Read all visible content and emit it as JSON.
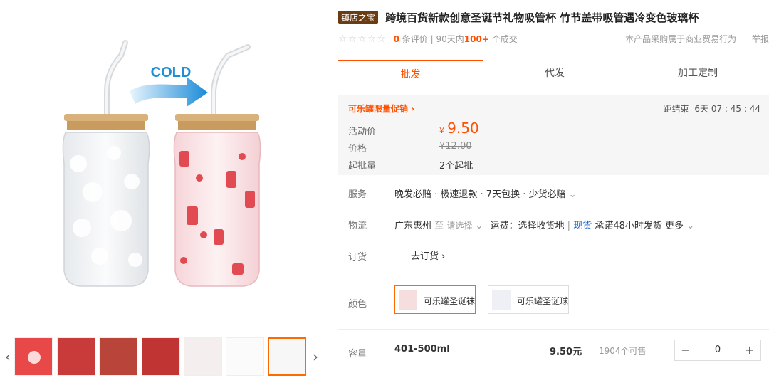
{
  "gallery": {
    "main_overlay": "COLD",
    "nav_prev": "‹",
    "nav_next": "›"
  },
  "product": {
    "badge": "镇店之宝",
    "title": "跨境百货新款创意圣诞节礼物吸管杯 竹节盖带吸管遇冷变色玻璃杯"
  },
  "rating": {
    "stars": "☆☆☆☆☆",
    "review_count": "0",
    "review_suffix": "条评价",
    "divider": "|",
    "sales_prefix": "90天内",
    "sales_count": "100+",
    "sales_suffix": "个成交",
    "notice": "本产品采购属于商业贸易行为",
    "notice_tail": "举报"
  },
  "tabs": [
    "批发",
    "代发",
    "加工定制"
  ],
  "promo": {
    "title": "可乐罐限量促销 ›",
    "countdown_label": "距结束",
    "countdown": "6天 07 : 45 : 44",
    "activity_label": "活动价",
    "currency": "¥",
    "activity_price": "9.50",
    "orig_label": "价格",
    "orig_price": "¥12.00",
    "moq_label": "起批量",
    "moq": "2个起批"
  },
  "service": {
    "label": "服务",
    "value": "晚发必赔 · 极速退款 · 7天包换 · 少货必赔",
    "chevron": "⌄"
  },
  "logistics": {
    "label": "物流",
    "origin": "广东惠州",
    "to": "至",
    "choose": "请选择",
    "chevron": "⌄",
    "fee": "运费：选择收货地",
    "stock": "现货",
    "promise": "承诺48小时发货",
    "more": "更多"
  },
  "order": {
    "label": "订货",
    "action": "去订货 ›"
  },
  "color": {
    "label": "颜色",
    "options": [
      "可乐罐圣诞袜",
      "可乐罐圣诞球"
    ]
  },
  "capacity": {
    "label": "容量",
    "value": "401-500ml",
    "price": "9.50元",
    "stock": "1904个可售",
    "qty": "0",
    "minus": "−",
    "plus": "+"
  }
}
